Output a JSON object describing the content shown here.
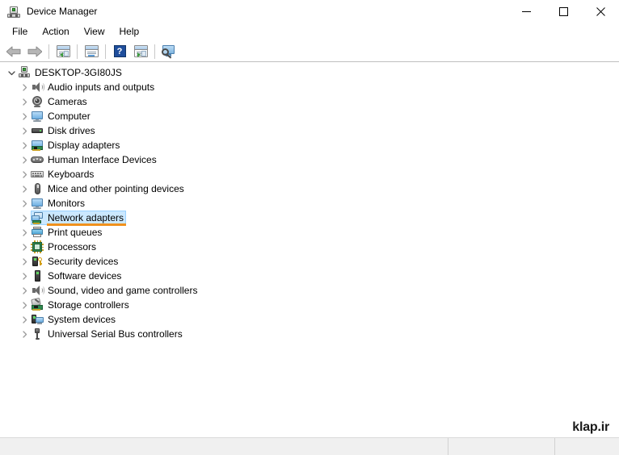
{
  "window": {
    "title": "Device Manager",
    "icon": "device-manager-icon",
    "controls": {
      "minimize": "minimize-button",
      "maximize": "maximize-button",
      "close": "close-button"
    }
  },
  "menubar": {
    "items": [
      {
        "label": "File"
      },
      {
        "label": "Action"
      },
      {
        "label": "View"
      },
      {
        "label": "Help"
      }
    ]
  },
  "toolbar": {
    "buttons": [
      {
        "name": "back-arrow-icon",
        "tooltip": "Back"
      },
      {
        "name": "forward-arrow-icon",
        "tooltip": "Forward"
      },
      {
        "name": "show-hide-console-tree-icon",
        "tooltip": "Show/Hide Console Tree"
      },
      {
        "name": "properties-icon",
        "tooltip": "Properties"
      },
      {
        "name": "help-icon",
        "tooltip": "Help",
        "glyph": "?"
      },
      {
        "name": "scan-for-hardware-changes-icon",
        "tooltip": "Scan for hardware changes"
      },
      {
        "name": "update-driver-icon",
        "tooltip": "Update driver"
      }
    ]
  },
  "tree": {
    "root": {
      "label": "DESKTOP-3GI80JS",
      "expanded": true,
      "icon": "computer-root-icon"
    },
    "nodes": [
      {
        "label": "Audio inputs and outputs",
        "icon": "speaker-icon",
        "selected": false
      },
      {
        "label": "Cameras",
        "icon": "camera-icon",
        "selected": false
      },
      {
        "label": "Computer",
        "icon": "monitor-icon",
        "selected": false
      },
      {
        "label": "Disk drives",
        "icon": "disk-drive-icon",
        "selected": false
      },
      {
        "label": "Display adapters",
        "icon": "display-adapter-icon",
        "selected": false
      },
      {
        "label": "Human Interface Devices",
        "icon": "hid-icon",
        "selected": false
      },
      {
        "label": "Keyboards",
        "icon": "keyboard-icon",
        "selected": false
      },
      {
        "label": "Mice and other pointing devices",
        "icon": "mouse-icon",
        "selected": false
      },
      {
        "label": "Monitors",
        "icon": "monitor-icon",
        "selected": false
      },
      {
        "label": "Network adapters",
        "icon": "network-adapter-icon",
        "selected": true,
        "annotated": true
      },
      {
        "label": "Print queues",
        "icon": "printer-icon",
        "selected": false
      },
      {
        "label": "Processors",
        "icon": "processor-icon",
        "selected": false
      },
      {
        "label": "Security devices",
        "icon": "security-device-icon",
        "selected": false
      },
      {
        "label": "Software devices",
        "icon": "software-device-icon",
        "selected": false
      },
      {
        "label": "Sound, video and game controllers",
        "icon": "speaker-icon",
        "selected": false
      },
      {
        "label": "Storage controllers",
        "icon": "storage-controller-icon",
        "selected": false
      },
      {
        "label": "System devices",
        "icon": "system-device-icon",
        "selected": false
      },
      {
        "label": "Universal Serial Bus controllers",
        "icon": "usb-icon",
        "selected": false
      }
    ]
  },
  "statusbar": {
    "pane1": "",
    "pane2": "",
    "pane3": ""
  },
  "watermark": {
    "text": "klap.ir"
  },
  "colors": {
    "selection_fill": "#cbe8ff",
    "selection_border": "#99d1ff",
    "annotation_underline": "#f0911d",
    "toolbar_border": "#bfbfbf",
    "statusbar_bg": "#f0f0f0"
  }
}
